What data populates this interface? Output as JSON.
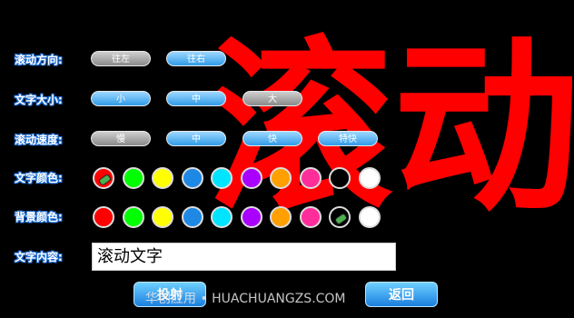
{
  "preview_text": "滚动",
  "direction": {
    "label": "滚动方向:",
    "options": [
      "往左",
      "往右"
    ]
  },
  "size": {
    "label": "文字大小:",
    "options": [
      "小",
      "中",
      "大"
    ]
  },
  "speed": {
    "label": "滚动速度:",
    "options": [
      "慢",
      "中",
      "快",
      "特快"
    ]
  },
  "text_color": {
    "label": "文字颜色:",
    "swatches": [
      "#ff0000",
      "#00ff00",
      "#ffff00",
      "#1e88e5",
      "#00e5ff",
      "#aa00ff",
      "#ffa000",
      "#ff2d9a",
      "#000000",
      "#ffffff"
    ],
    "selected_index": 0
  },
  "bg_color": {
    "label": "背景颜色:",
    "swatches": [
      "#ff0000",
      "#00ff00",
      "#ffff00",
      "#1e88e5",
      "#00e5ff",
      "#aa00ff",
      "#ffa000",
      "#ff2d9a",
      "#000000",
      "#ffffff"
    ],
    "selected_index": 8
  },
  "content": {
    "label": "文字内容:",
    "value": "滚动文字"
  },
  "buttons": {
    "launch": "投射",
    "back": "返回"
  },
  "watermark": "华创应用 • HUACHUANGZS.COM"
}
